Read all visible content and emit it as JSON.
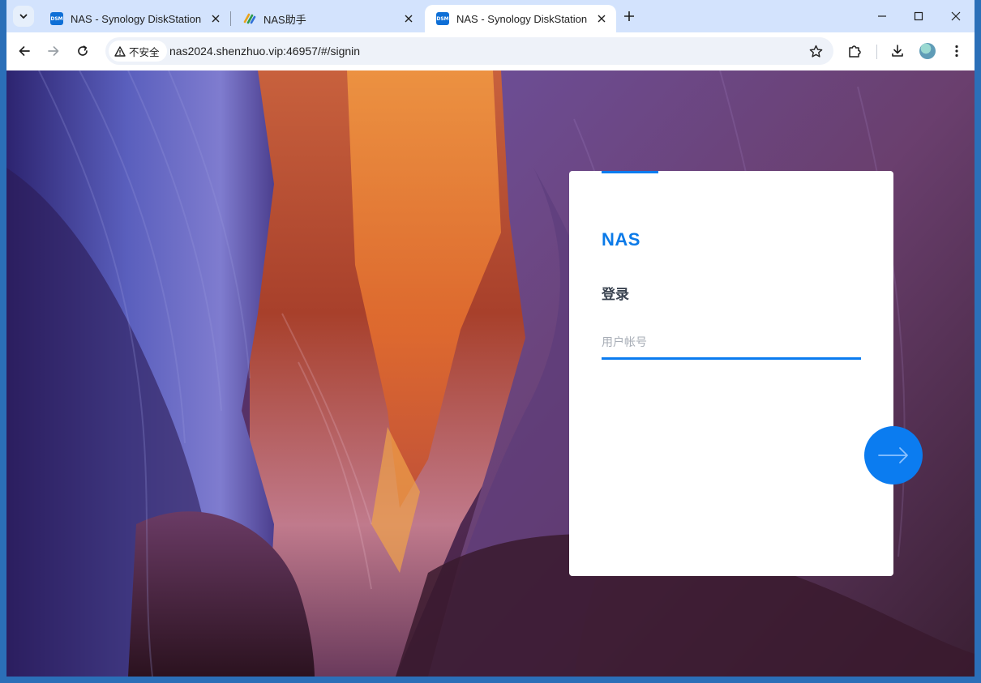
{
  "tabs": [
    {
      "title": "NAS - Synology DiskStation",
      "favicon": "DSM",
      "active": false
    },
    {
      "title": "NAS助手",
      "favicon": "",
      "active": false
    },
    {
      "title": "NAS - Synology DiskStation",
      "favicon": "DSM",
      "active": true
    }
  ],
  "toolbar": {
    "security_label": "不安全",
    "url": "nas2024.shenzhuo.vip:46957/#/signin"
  },
  "login": {
    "brand": "NAS",
    "heading": "登录",
    "username_placeholder": "用户帐号"
  },
  "colors": {
    "accent": "#0b7cf0",
    "tabstrip": "#d3e3fd"
  },
  "icons": {
    "signin": "arrow-right-icon",
    "window": [
      "minimize-icon",
      "maximize-icon",
      "close-window-icon"
    ]
  }
}
